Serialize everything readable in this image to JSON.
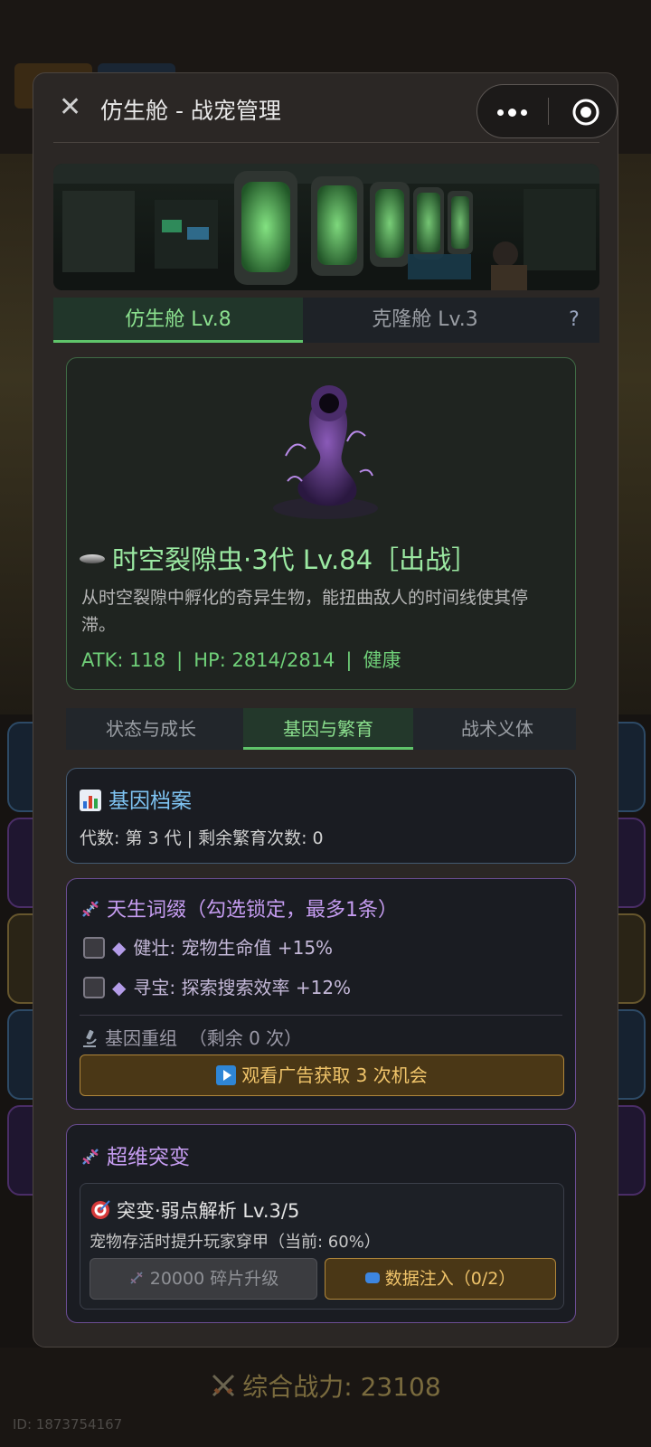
{
  "window": {
    "title": "仿生舱 - 战宠管理"
  },
  "pod_tabs": [
    {
      "label": "仿生舱 Lv.8",
      "active": true
    },
    {
      "label": "克隆舱 Lv.3",
      "active": false
    }
  ],
  "help_label": "?",
  "pet": {
    "name": "时空裂隙虫·3代  Lv.84［出战］",
    "description": "从时空裂隙中孵化的奇异生物，能扭曲敌人的时间线使其停滞。",
    "atk": "ATK: 118",
    "hp": "HP: 2814/2814",
    "status": "健康",
    "separator": "|"
  },
  "sub_tabs": [
    {
      "label": "状态与成长",
      "active": false
    },
    {
      "label": "基因与繁育",
      "active": true
    },
    {
      "label": "战术义体",
      "active": false
    }
  ],
  "gene_archive": {
    "title": "基因档案",
    "summary": "代数: 第 3 代  |  剩余繁育次数: 0"
  },
  "innate_traits": {
    "title": "天生词缀（勾选锁定，最多1条）",
    "items": [
      {
        "text": "健壮: 宠物生命值 +15%",
        "checked": false
      },
      {
        "text": "寻宝: 探索搜索效率 +12%",
        "checked": false
      }
    ],
    "regroup_label": "基因重组",
    "regroup_remaining": "（剩余 0 次）",
    "ad_button": "观看广告获取 3 次机会"
  },
  "mutation": {
    "title": "超维突变",
    "name": "突变·弱点解析  Lv.3/5",
    "description": "宠物存活时提升玩家穿甲（当前: 60%）",
    "upgrade_button": "20000 碎片升级",
    "inject_button": "数据注入（0/2）"
  },
  "background": {
    "power_label": "综合战力: 23108",
    "uid": "ID: 1873754167"
  },
  "colors": {
    "accent_green": "#5fc46a",
    "pet_name": "#9be9a2",
    "gene_blue": "#7ec3f2",
    "trait_purple": "#c59cf0",
    "ad_gold": "#f0c46a"
  }
}
